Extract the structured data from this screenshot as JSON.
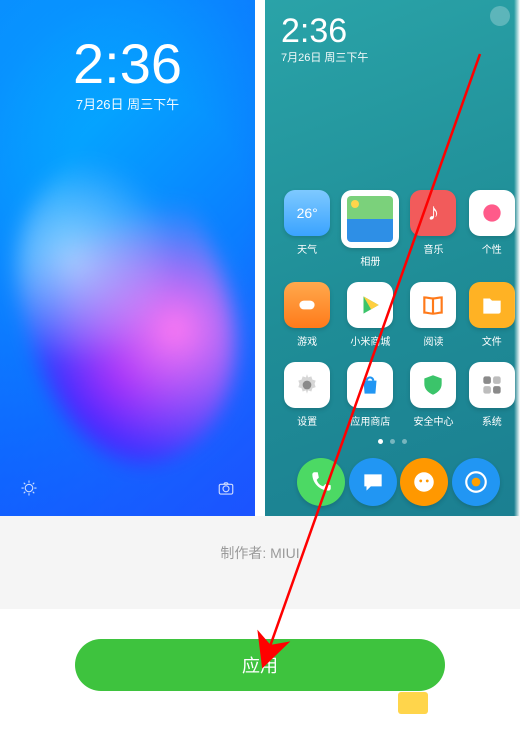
{
  "lock": {
    "time": "2:36",
    "date": "7月26日 周三下午"
  },
  "home": {
    "time": "2:36",
    "date": "7月26日 周三下午",
    "weather_temp": "26°",
    "apps": [
      {
        "id": "weather",
        "label": "天气"
      },
      {
        "id": "gallery",
        "label": "相册"
      },
      {
        "id": "music",
        "label": "音乐"
      },
      {
        "id": "personalize",
        "label": "个性"
      },
      {
        "id": "games",
        "label": "游戏"
      },
      {
        "id": "mi-store",
        "label": "小米商城"
      },
      {
        "id": "reader",
        "label": "阅读"
      },
      {
        "id": "files",
        "label": "文件"
      },
      {
        "id": "settings",
        "label": "设置"
      },
      {
        "id": "app-store",
        "label": "应用商店"
      },
      {
        "id": "security",
        "label": "安全中心"
      },
      {
        "id": "tools",
        "label": "系统"
      }
    ],
    "dock": [
      {
        "id": "phone"
      },
      {
        "id": "messages"
      },
      {
        "id": "chat"
      },
      {
        "id": "browser"
      }
    ]
  },
  "meta": {
    "author_label": "制作者: MIUI"
  },
  "footer": {
    "apply_label": "应用"
  }
}
